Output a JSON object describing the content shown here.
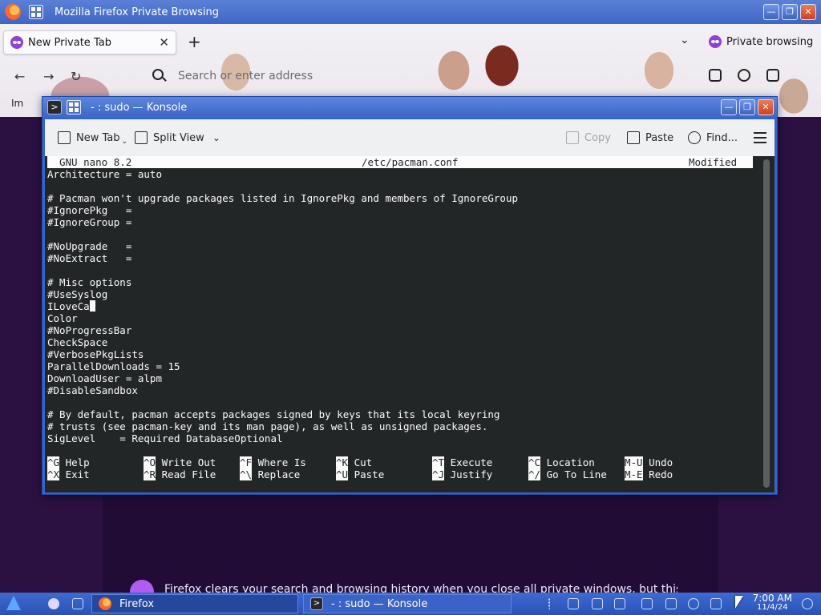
{
  "firefox": {
    "window_title": "Mozilla Firefox Private Browsing",
    "tab_label": "New Private Tab",
    "tab_close": "✕",
    "new_tab": "+",
    "list_tabs": "⌄",
    "private_label": "Private browsing",
    "url_placeholder": "Search or enter address",
    "import_label": "Im",
    "banner_text": "Firefox clears your search and browsing history when you close all private windows, but this"
  },
  "konsole": {
    "window_title": "- : sudo — Konsole",
    "toolbar": {
      "new_tab": "New Tab",
      "split_view": "Split View",
      "copy": "Copy",
      "paste": "Paste",
      "find": "Find..."
    },
    "nano": {
      "version": "GNU nano 8.2",
      "filename": "/etc/pacman.conf",
      "status": "Modified",
      "lines": [
        "Architecture = auto",
        "",
        "# Pacman won't upgrade packages listed in IgnorePkg and members of IgnoreGroup",
        "#IgnorePkg   =",
        "#IgnoreGroup =",
        "",
        "#NoUpgrade   =",
        "#NoExtract   =",
        "",
        "# Misc options",
        "#UseSyslog",
        "ILoveCa",
        "Color",
        "#NoProgressBar",
        "CheckSpace",
        "#VerbosePkgLists",
        "ParallelDownloads = 15",
        "DownloadUser = alpm",
        "#DisableSandbox",
        "",
        "# By default, pacman accepts packages signed by keys that its local keyring",
        "# trusts (see pacman-key and its man page), as well as unsigned packages.",
        "SigLevel    = Required DatabaseOptional"
      ],
      "shortcuts_row1": [
        {
          "key": "^G",
          "label": "Help"
        },
        {
          "key": "^O",
          "label": "Write Out"
        },
        {
          "key": "^F",
          "label": "Where Is"
        },
        {
          "key": "^K",
          "label": "Cut"
        },
        {
          "key": "^T",
          "label": "Execute"
        },
        {
          "key": "^C",
          "label": "Location"
        },
        {
          "key": "M-U",
          "label": "Undo"
        }
      ],
      "shortcuts_row2": [
        {
          "key": "^X",
          "label": "Exit"
        },
        {
          "key": "^R",
          "label": "Read File"
        },
        {
          "key": "^\\",
          "label": "Replace"
        },
        {
          "key": "^U",
          "label": "Paste"
        },
        {
          "key": "^J",
          "label": "Justify"
        },
        {
          "key": "^/",
          "label": "Go To Line"
        },
        {
          "key": "M-E",
          "label": "Redo"
        }
      ]
    }
  },
  "taskbar": {
    "firefox_task": "Firefox",
    "konsole_task": "- : sudo — Konsole",
    "clock_time": "7:00 AM",
    "clock_date": "11/4/24"
  }
}
